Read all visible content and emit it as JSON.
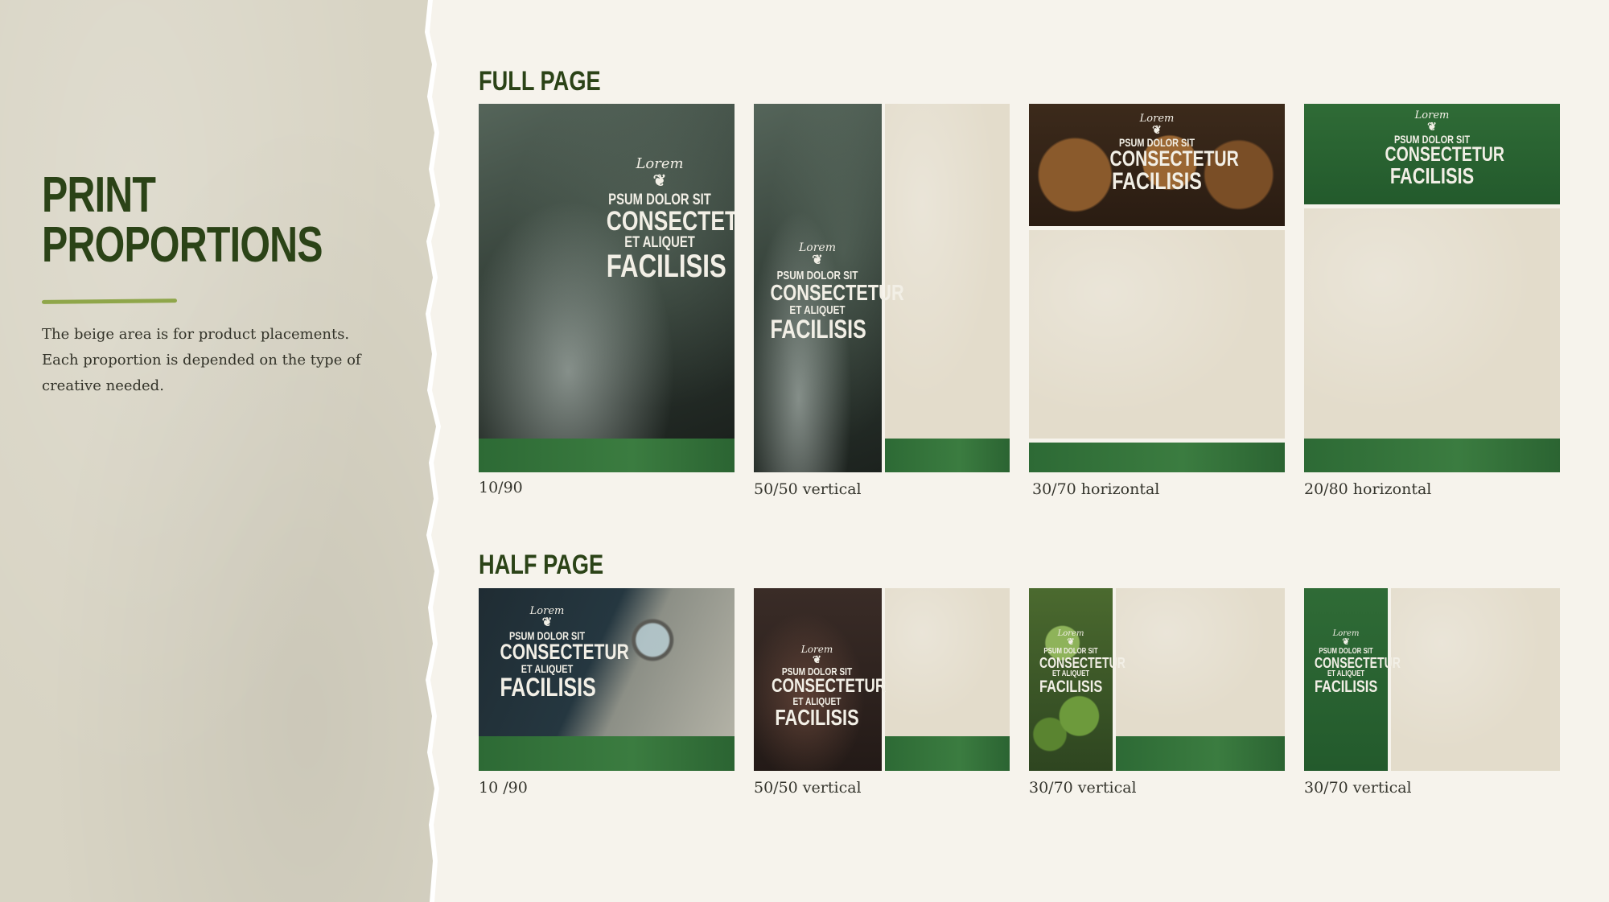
{
  "page": {
    "title_line1": "PRINT",
    "title_line2": "PROPORTIONS",
    "description": "The beige area is for product placements. Each proportion is depended on the type of creative needed."
  },
  "full_page": {
    "title": "FULL PAGE",
    "cards": [
      {
        "caption": "10/90"
      },
      {
        "caption": "50/50 vertical"
      },
      {
        "caption": "30/70 horizontal"
      },
      {
        "caption": "20/80 horizontal"
      }
    ]
  },
  "half_page": {
    "title": "HALF PAGE",
    "cards": [
      {
        "caption": "10 /90"
      },
      {
        "caption": "50/50 vertical"
      },
      {
        "caption": "30/70 vertical"
      },
      {
        "caption": "30/70 vertical"
      }
    ]
  },
  "lockup": {
    "script": "Lorem",
    "icon": "grape-cluster-icon",
    "line1": "PSUM DOLOR SIT",
    "line2": "CONSECTETUR",
    "line3": "ET ALIQUET",
    "line4": "FACILISIS"
  },
  "colors": {
    "brand_green": "#2d6a35",
    "title_green": "#2b4317",
    "beige": "#e3dccb",
    "accent_underline": "#8fa64a"
  }
}
